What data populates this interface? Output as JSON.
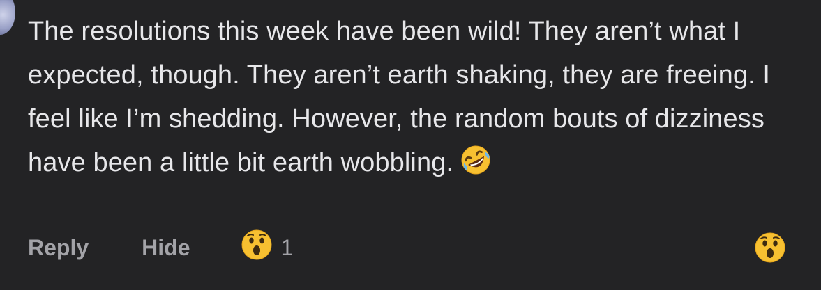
{
  "comment": {
    "text": "The resolutions this week have been wild! They aren’t what I expected, though. They aren’t earth shaking, they are freeing. I feel like I’m shedding. However, the random bouts of dizziness have been a little bit earth wobbling.",
    "trailing_emoji": "rolling-on-floor-laughing-emoji"
  },
  "actions": {
    "reply_label": "Reply",
    "hide_label": "Hide",
    "reaction": {
      "emoji": "surprised-face-emoji",
      "count": "1"
    },
    "react_button_emoji": "surprised-face-emoji"
  },
  "colors": {
    "background": "#232325",
    "text": "#e7e7ea",
    "muted": "#a3a3a8",
    "emoji_yellow": "#f7c031"
  }
}
